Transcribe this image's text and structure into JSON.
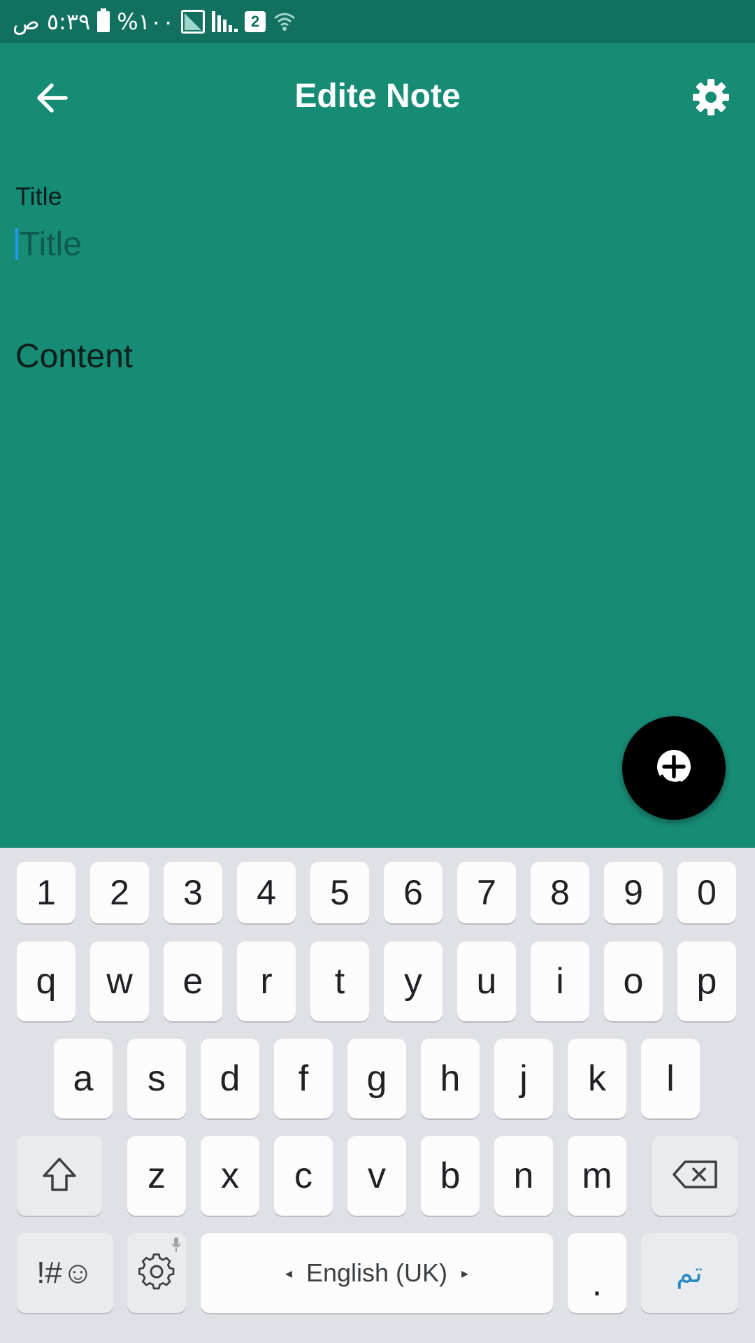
{
  "status_bar": {
    "time": "٥:٣٩ ص",
    "battery": "%١٠٠",
    "sim_badge": "2"
  },
  "app_bar": {
    "title": "Edite Note",
    "back_icon": "arrow-left-icon",
    "settings_icon": "gear-icon"
  },
  "form": {
    "title_label": "Title",
    "title_placeholder": "Title",
    "title_value": "",
    "content_placeholder": "Content"
  },
  "fab": {
    "icon": "plus-circle-icon"
  },
  "colors": {
    "status_bar": "#12705f",
    "app_background": "#178c75",
    "fab": "#000000",
    "caret": "#2196f3",
    "keyboard": "#dfe1e6"
  },
  "keyboard": {
    "row_numbers": [
      "1",
      "2",
      "3",
      "4",
      "5",
      "6",
      "7",
      "8",
      "9",
      "0"
    ],
    "row_1": [
      "q",
      "w",
      "e",
      "r",
      "t",
      "y",
      "u",
      "i",
      "o",
      "p"
    ],
    "row_2": [
      "a",
      "s",
      "d",
      "f",
      "g",
      "h",
      "j",
      "k",
      "l"
    ],
    "row_3": [
      "z",
      "x",
      "c",
      "v",
      "b",
      "n",
      "m"
    ],
    "shift_icon": "shift-arrow-icon",
    "backspace_icon": "backspace-icon",
    "symbols_label": "!#☺",
    "settings_icon": "keyboard-settings-icon",
    "mic_icon": "mic-icon",
    "space_label": "English (UK)",
    "period_label": ".",
    "action_label": "تم"
  }
}
